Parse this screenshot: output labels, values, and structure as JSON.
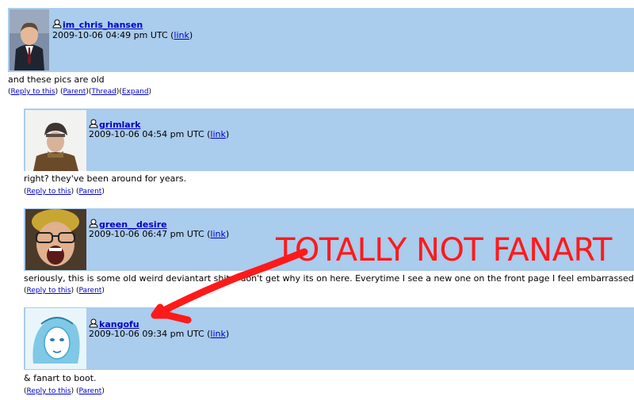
{
  "comments": [
    {
      "username": "im_chris_hansen",
      "date": "2009-10-06 04:49 pm UTC",
      "link_label": "link",
      "body": "and these pics are old",
      "actions": [
        "Reply to this",
        "Parent",
        "Thread",
        "Expand"
      ]
    },
    {
      "username": "grimlark",
      "date": "2009-10-06 04:54 pm UTC",
      "link_label": "link",
      "body": "right? they've been around for years.",
      "actions": [
        "Reply to this",
        "Parent"
      ]
    },
    {
      "username": "green__desire",
      "date": "2009-10-06 06:47 pm UTC",
      "link_label": "link",
      "body": "seriously, this is some old weird deviantart shit. I don't get why its on here. Everytime I see a new one on the front page I feel embarrassed.",
      "actions": [
        "Reply to this",
        "Parent"
      ]
    },
    {
      "username": "kangofu",
      "date": "2009-10-06 09:34 pm UTC",
      "link_label": "link",
      "body": "& fanart to boot.",
      "actions": [
        "Reply to this",
        "Parent"
      ]
    }
  ],
  "annotation": {
    "text": "TOTALLY NOT FANART",
    "color": "#ff1a1a"
  },
  "colors": {
    "header_bg": "#aacced",
    "link": "#0000cc"
  }
}
